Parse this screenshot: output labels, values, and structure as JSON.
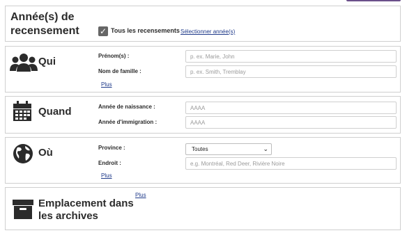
{
  "years": {
    "title": "Année(s) de recensement",
    "checkbox_label": "Tous les recensements",
    "checkbox_checked": true,
    "select_link": "Sélectionner année(s)"
  },
  "qui": {
    "title": "Qui",
    "icon": "people-icon",
    "fields": [
      {
        "label": "Prénom(s) :",
        "placeholder": "p. ex. Marie, John"
      },
      {
        "label": "Nom de famille :",
        "placeholder": "p. ex. Smith, Tremblay"
      }
    ],
    "plus": "Plus"
  },
  "quand": {
    "title": "Quand",
    "icon": "calendar-icon",
    "fields": [
      {
        "label": "Année de naissance :",
        "placeholder": "AAAA"
      },
      {
        "label": "Année d'immigration :",
        "placeholder": "AAAA"
      }
    ]
  },
  "ou": {
    "title": "Où",
    "icon": "globe-icon",
    "province_label": "Province :",
    "province_value": "Toutes",
    "endroit_label": "Endroit :",
    "endroit_placeholder": "e.g. Montréal, Red Deer, Rivière Noire",
    "plus": "Plus"
  },
  "emplacement": {
    "title": "Emplacement dans les archives",
    "icon": "archive-box-icon",
    "plus": "Plus"
  },
  "colors": {
    "accent": "#6b4f8a",
    "link": "#1f3a8a",
    "border": "#cfcfcf"
  }
}
